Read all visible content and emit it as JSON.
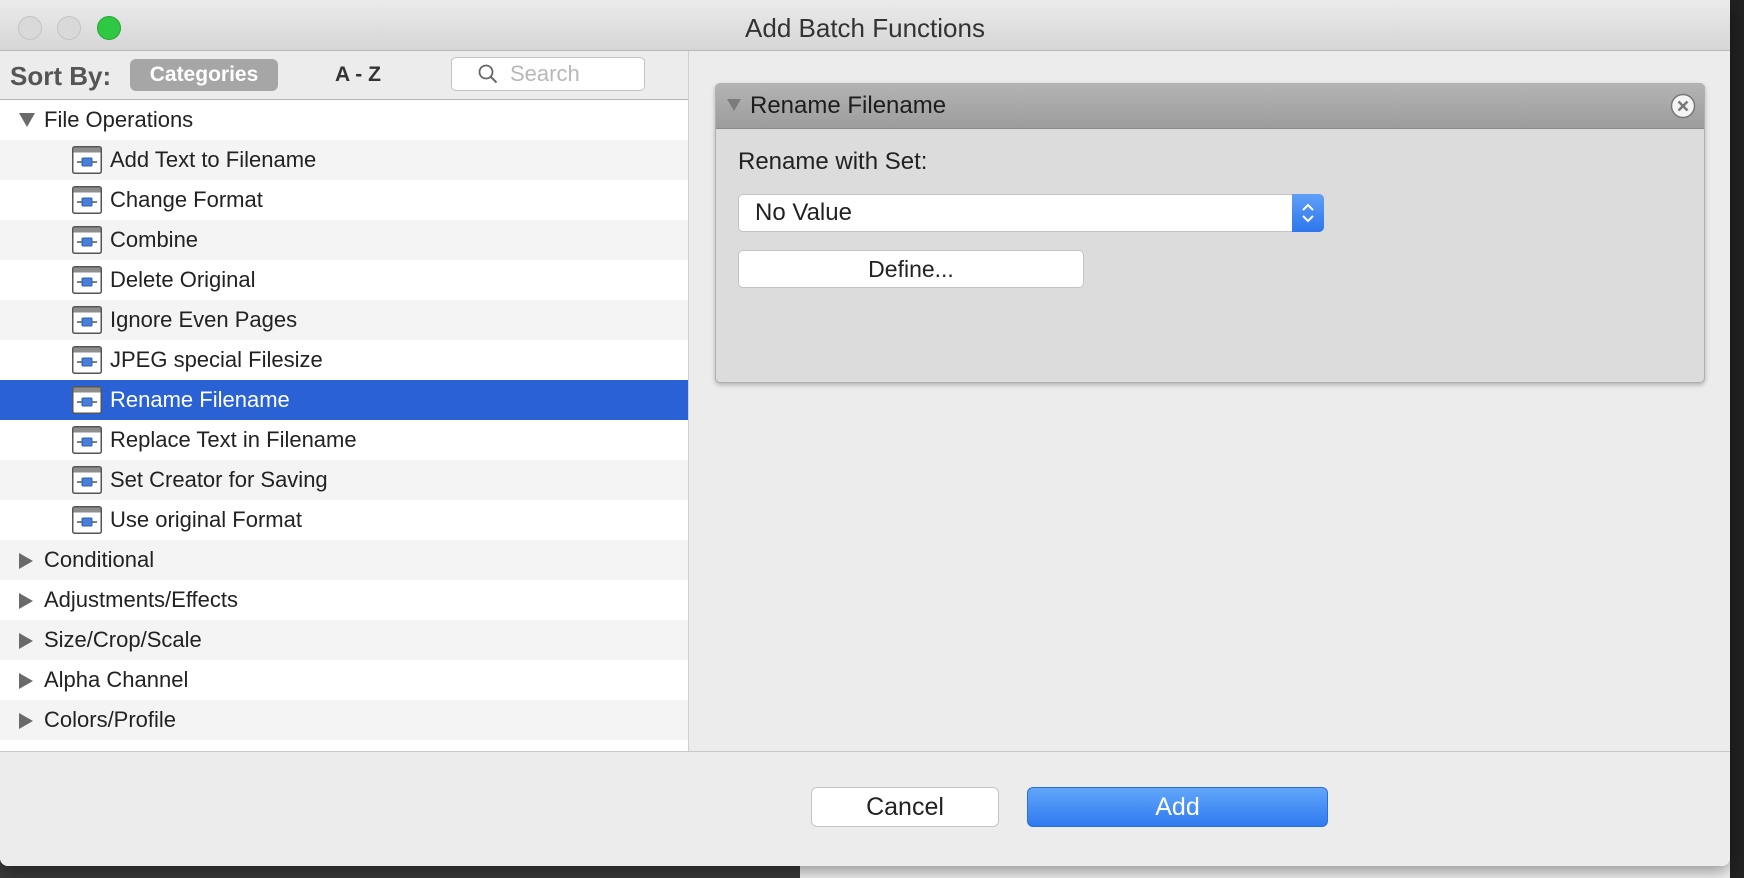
{
  "window": {
    "title": "Add Batch Functions"
  },
  "sort": {
    "label": "Sort By:",
    "categories_label": "Categories",
    "az_label": "A - Z",
    "search_placeholder": "Search"
  },
  "tree": {
    "file_operations": {
      "label": "File Operations",
      "items": [
        "Add Text to Filename",
        "Change Format",
        "Combine",
        "Delete Original",
        "Ignore Even Pages",
        "JPEG special Filesize",
        "Rename Filename",
        "Replace Text in Filename",
        "Set Creator for Saving",
        "Use original Format"
      ],
      "selected_item": "Rename Filename"
    },
    "collapsed_categories": [
      "Conditional",
      "Adjustments/Effects",
      "Size/Crop/Scale",
      "Alpha Channel",
      "Colors/Profile"
    ]
  },
  "panel": {
    "title": "Rename Filename",
    "field_label": "Rename with Set:",
    "select_value": "No Value",
    "define_label": "Define..."
  },
  "footer": {
    "cancel_label": "Cancel",
    "add_label": "Add"
  },
  "colors": {
    "selection": "#2a62d6",
    "accent_button": "#3a82f3",
    "zoom_button": "#2fc843"
  }
}
